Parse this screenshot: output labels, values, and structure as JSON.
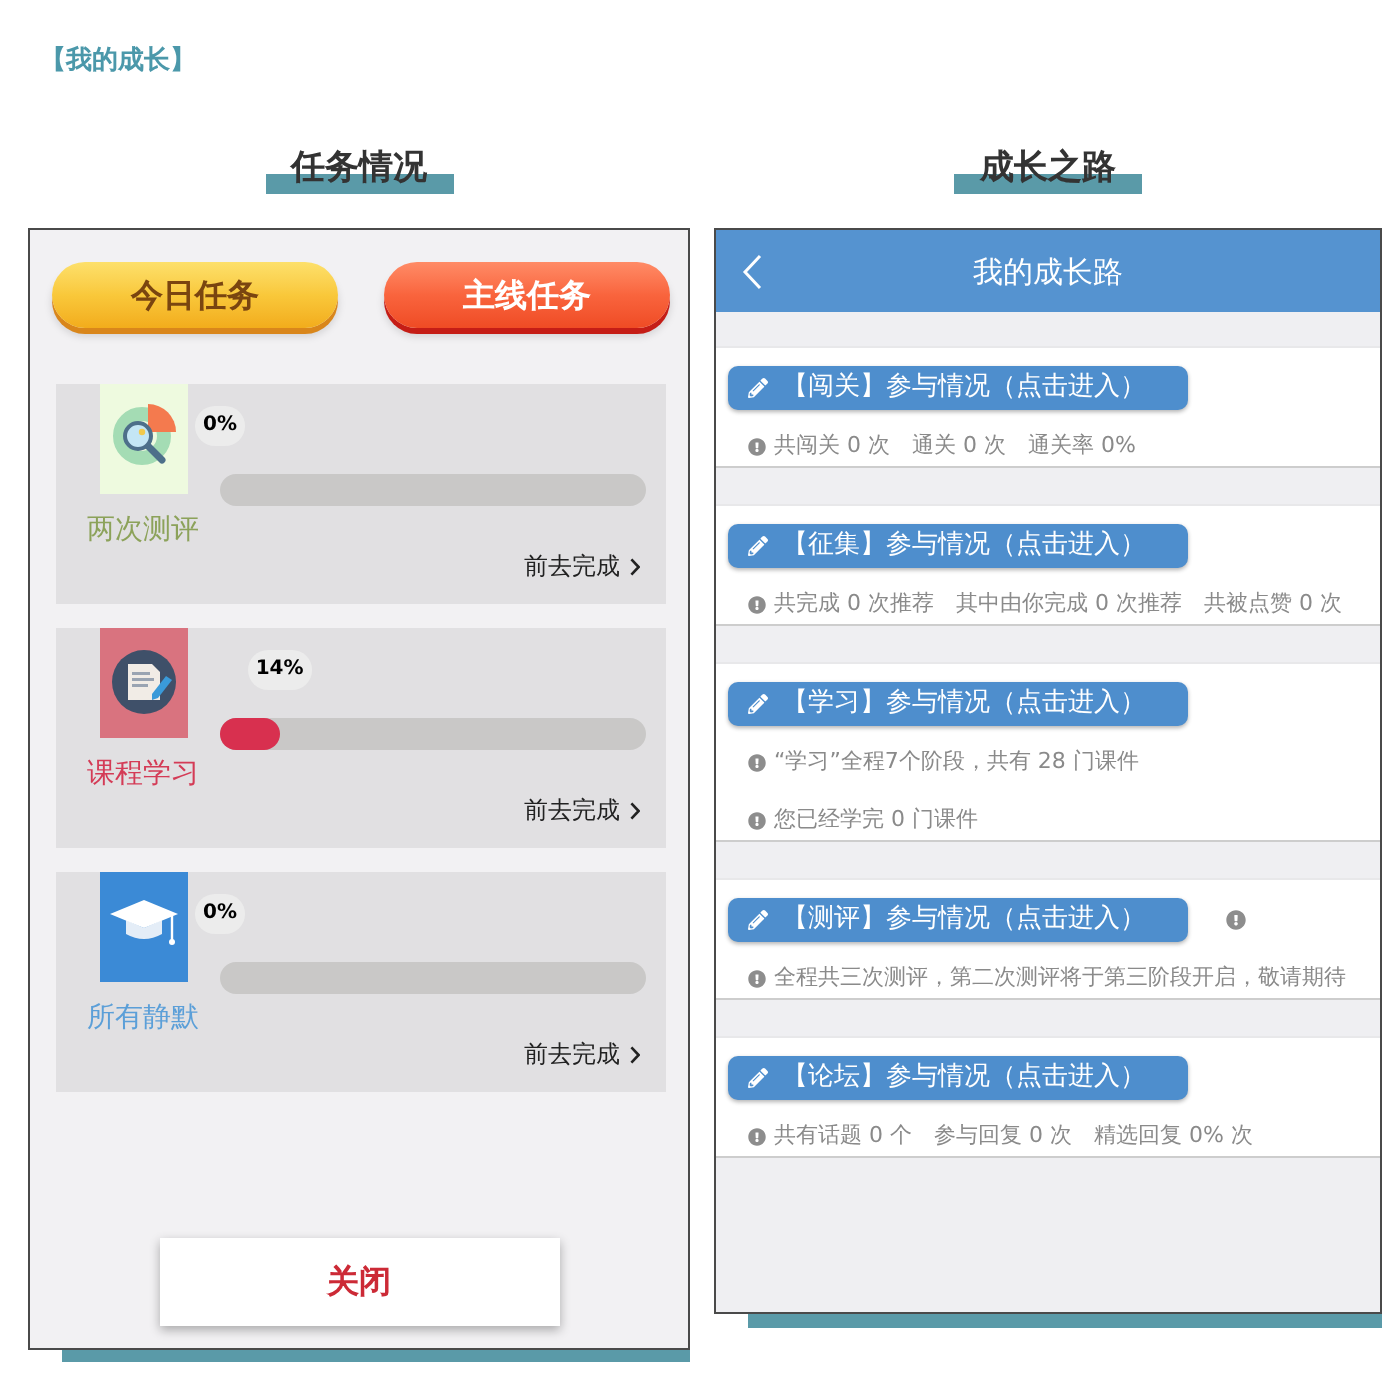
{
  "page_title": "【我的成长】",
  "task_panel": {
    "heading": "任务情况",
    "buttons": [
      {
        "label": "今日任务",
        "kind": "daily"
      },
      {
        "label": "主线任务",
        "kind": "main"
      }
    ],
    "tasks": [
      {
        "kind": "evaluation",
        "label": "两次测评",
        "color": "#8ca25a",
        "percent": "0%",
        "level": 0,
        "link": "前去完成"
      },
      {
        "kind": "course",
        "label": "课程学习",
        "color": "#d43b56",
        "percent": "14%",
        "level": 0.14,
        "link": "前去完成"
      },
      {
        "kind": "graduation",
        "label": "所有静默",
        "color": "#5b9fd8",
        "percent": "0%",
        "level": 0,
        "link": "前去完成"
      }
    ],
    "close_button": "关闭"
  },
  "growth_panel": {
    "heading": "成长之路",
    "screen_title": "我的成长路",
    "sections": [
      {
        "button": "【闯关】参与情况（点击进入）",
        "notice": false,
        "info_lines": [
          [
            "共闯关 0 次",
            "通关 0 次",
            "通关率 0%"
          ]
        ]
      },
      {
        "button": "【征集】参与情况（点击进入）",
        "notice": false,
        "info_lines": [
          [
            "共完成 0 次推荐",
            "其中由你完成 0 次推荐",
            "共被点赞 0 次"
          ]
        ]
      },
      {
        "button": "【学习】参与情况（点击进入）",
        "notice": false,
        "info_lines": [
          [
            "“学习”全程7个阶段，共有 28 门课件"
          ],
          [
            "您已经学完 0 门课件"
          ]
        ]
      },
      {
        "button": "【测评】参与情况（点击进入）",
        "notice": true,
        "info_lines": [
          [
            "全程共三次测评，第二次测评将于第三阶段开启，敬请期待"
          ]
        ]
      },
      {
        "button": "【论坛】参与情况（点击进入）",
        "notice": false,
        "info_lines": [
          [
            "共有话题 0 个",
            "参与回复 0 次",
            "精选回复 0% 次"
          ]
        ]
      }
    ]
  }
}
